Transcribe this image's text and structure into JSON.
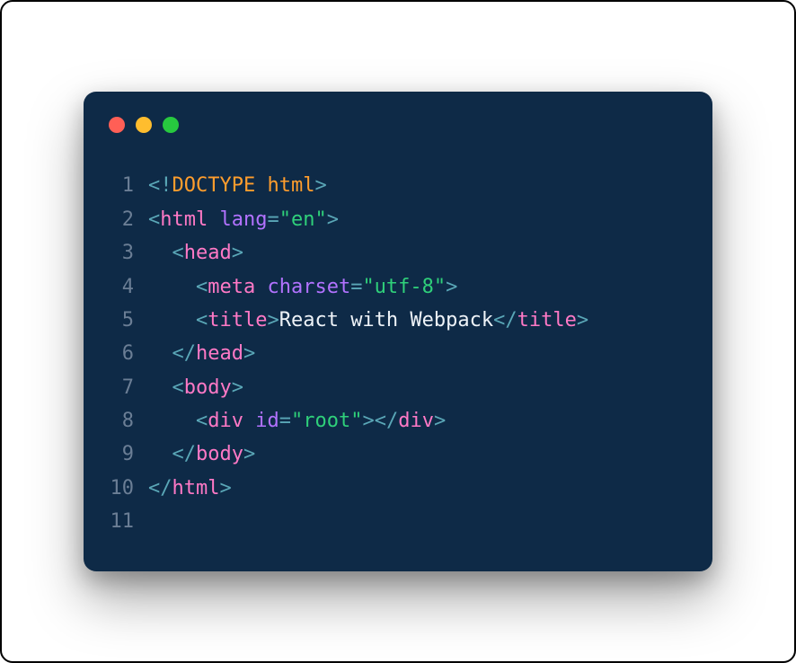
{
  "traffic": {
    "red": "#ff5f56",
    "yellow": "#ffbd2e",
    "green": "#27c93f"
  },
  "code": {
    "lines": [
      {
        "n": "1",
        "tokens": [
          {
            "t": "br",
            "v": "<!"
          },
          {
            "t": "doctype-kw",
            "v": "DOCTYPE"
          },
          {
            "t": "txt",
            "v": " "
          },
          {
            "t": "doctype-name",
            "v": "html"
          },
          {
            "t": "br",
            "v": ">"
          }
        ]
      },
      {
        "n": "2",
        "tokens": [
          {
            "t": "br",
            "v": "<"
          },
          {
            "t": "tag",
            "v": "html"
          },
          {
            "t": "txt",
            "v": " "
          },
          {
            "t": "attr",
            "v": "lang"
          },
          {
            "t": "eq",
            "v": "="
          },
          {
            "t": "str",
            "v": "\"en\""
          },
          {
            "t": "br",
            "v": ">"
          }
        ]
      },
      {
        "n": "3",
        "tokens": [
          {
            "t": "txt",
            "v": "  "
          },
          {
            "t": "br",
            "v": "<"
          },
          {
            "t": "tag",
            "v": "head"
          },
          {
            "t": "br",
            "v": ">"
          }
        ]
      },
      {
        "n": "4",
        "tokens": [
          {
            "t": "txt",
            "v": "    "
          },
          {
            "t": "br",
            "v": "<"
          },
          {
            "t": "tag",
            "v": "meta"
          },
          {
            "t": "txt",
            "v": " "
          },
          {
            "t": "attr",
            "v": "charset"
          },
          {
            "t": "eq",
            "v": "="
          },
          {
            "t": "str",
            "v": "\"utf-8\""
          },
          {
            "t": "br",
            "v": ">"
          }
        ]
      },
      {
        "n": "5",
        "tokens": [
          {
            "t": "txt",
            "v": "    "
          },
          {
            "t": "br",
            "v": "<"
          },
          {
            "t": "tag",
            "v": "title"
          },
          {
            "t": "br",
            "v": ">"
          },
          {
            "t": "txt",
            "v": "React with Webpack"
          },
          {
            "t": "br",
            "v": "</"
          },
          {
            "t": "tag",
            "v": "title"
          },
          {
            "t": "br",
            "v": ">"
          }
        ]
      },
      {
        "n": "6",
        "tokens": [
          {
            "t": "txt",
            "v": "  "
          },
          {
            "t": "br",
            "v": "</"
          },
          {
            "t": "tag",
            "v": "head"
          },
          {
            "t": "br",
            "v": ">"
          }
        ]
      },
      {
        "n": "7",
        "tokens": [
          {
            "t": "txt",
            "v": "  "
          },
          {
            "t": "br",
            "v": "<"
          },
          {
            "t": "tag",
            "v": "body"
          },
          {
            "t": "br",
            "v": ">"
          }
        ]
      },
      {
        "n": "8",
        "tokens": [
          {
            "t": "txt",
            "v": "    "
          },
          {
            "t": "br",
            "v": "<"
          },
          {
            "t": "tag",
            "v": "div"
          },
          {
            "t": "txt",
            "v": " "
          },
          {
            "t": "attr",
            "v": "id"
          },
          {
            "t": "eq",
            "v": "="
          },
          {
            "t": "str",
            "v": "\"root\""
          },
          {
            "t": "br",
            "v": ">"
          },
          {
            "t": "br",
            "v": "</"
          },
          {
            "t": "tag",
            "v": "div"
          },
          {
            "t": "br",
            "v": ">"
          }
        ]
      },
      {
        "n": "9",
        "tokens": [
          {
            "t": "txt",
            "v": "  "
          },
          {
            "t": "br",
            "v": "</"
          },
          {
            "t": "tag",
            "v": "body"
          },
          {
            "t": "br",
            "v": ">"
          }
        ]
      },
      {
        "n": "10",
        "tokens": [
          {
            "t": "br",
            "v": "</"
          },
          {
            "t": "tag",
            "v": "html"
          },
          {
            "t": "br",
            "v": ">"
          }
        ]
      },
      {
        "n": "11",
        "tokens": []
      }
    ]
  }
}
